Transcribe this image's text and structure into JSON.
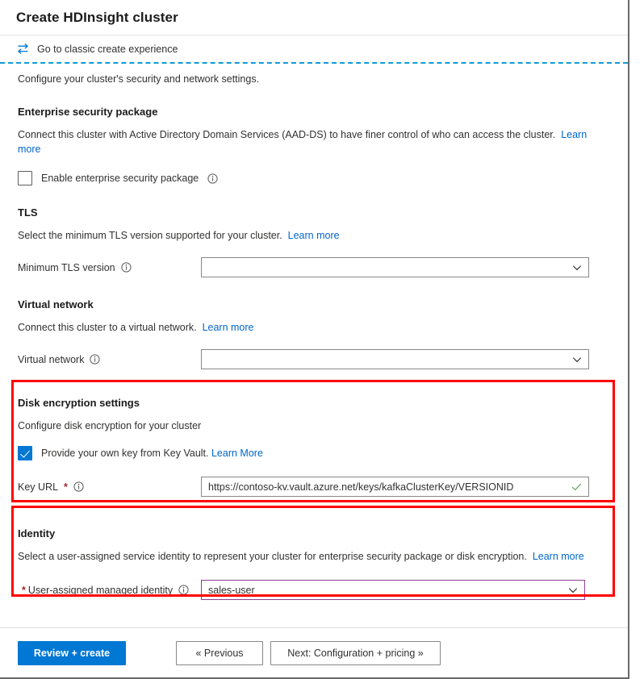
{
  "window": {
    "title": "Create HDInsight cluster"
  },
  "commandbar": {
    "classic_label": "Go to classic create experience",
    "swap_icon": "swap-arrows-icon",
    "accent": "#0078d4"
  },
  "intro": "Configure your cluster's security and network settings.",
  "sections": {
    "esp": {
      "heading": "Enterprise security package",
      "description": "Connect this cluster with Active Directory Domain Services (AAD-DS) to have finer control of who can access the cluster.",
      "learn_more": "Learn more",
      "checkbox_label": "Enable enterprise security package",
      "checked": false,
      "info_icon": "info-icon"
    },
    "tls": {
      "heading": "TLS",
      "description": "Select the minimum TLS version supported for your cluster.",
      "learn_more": "Learn more",
      "field_label": "Minimum TLS version",
      "field_value": "",
      "info_icon": "info-icon",
      "chevron_icon": "chevron-down-icon"
    },
    "vnet": {
      "heading": "Virtual network",
      "description": "Connect this cluster to a virtual network.",
      "learn_more": "Learn more",
      "field_label": "Virtual network",
      "field_value": "",
      "info_icon": "info-icon",
      "chevron_icon": "chevron-down-icon"
    },
    "disk": {
      "heading": "Disk encryption settings",
      "description": "Configure disk encryption for your cluster",
      "checkbox_label": "Provide your own key from Key Vault.",
      "checkbox_learn_more": "Learn More",
      "checked": true,
      "field_label": "Key URL",
      "required_mark": "*",
      "field_value": "https://contoso-kv.vault.azure.net/keys/kafkaClusterKey/VERSIONID",
      "info_icon": "info-icon",
      "validation_icon": "checkmark-valid-icon",
      "highlight_color": "#ff0000"
    },
    "identity": {
      "heading": "Identity",
      "description": "Select a user-assigned service identity to represent your cluster for enterprise security package or disk encryption.",
      "learn_more": "Learn more",
      "required_mark": "*",
      "field_label": "User-assigned managed identity",
      "field_value": "sales-user",
      "info_icon": "info-icon",
      "chevron_icon": "chevron-down-icon",
      "highlight_color": "#ff0000"
    }
  },
  "footer": {
    "review_create": "Review + create",
    "previous": "« Previous",
    "next": "Next: Configuration + pricing »"
  }
}
